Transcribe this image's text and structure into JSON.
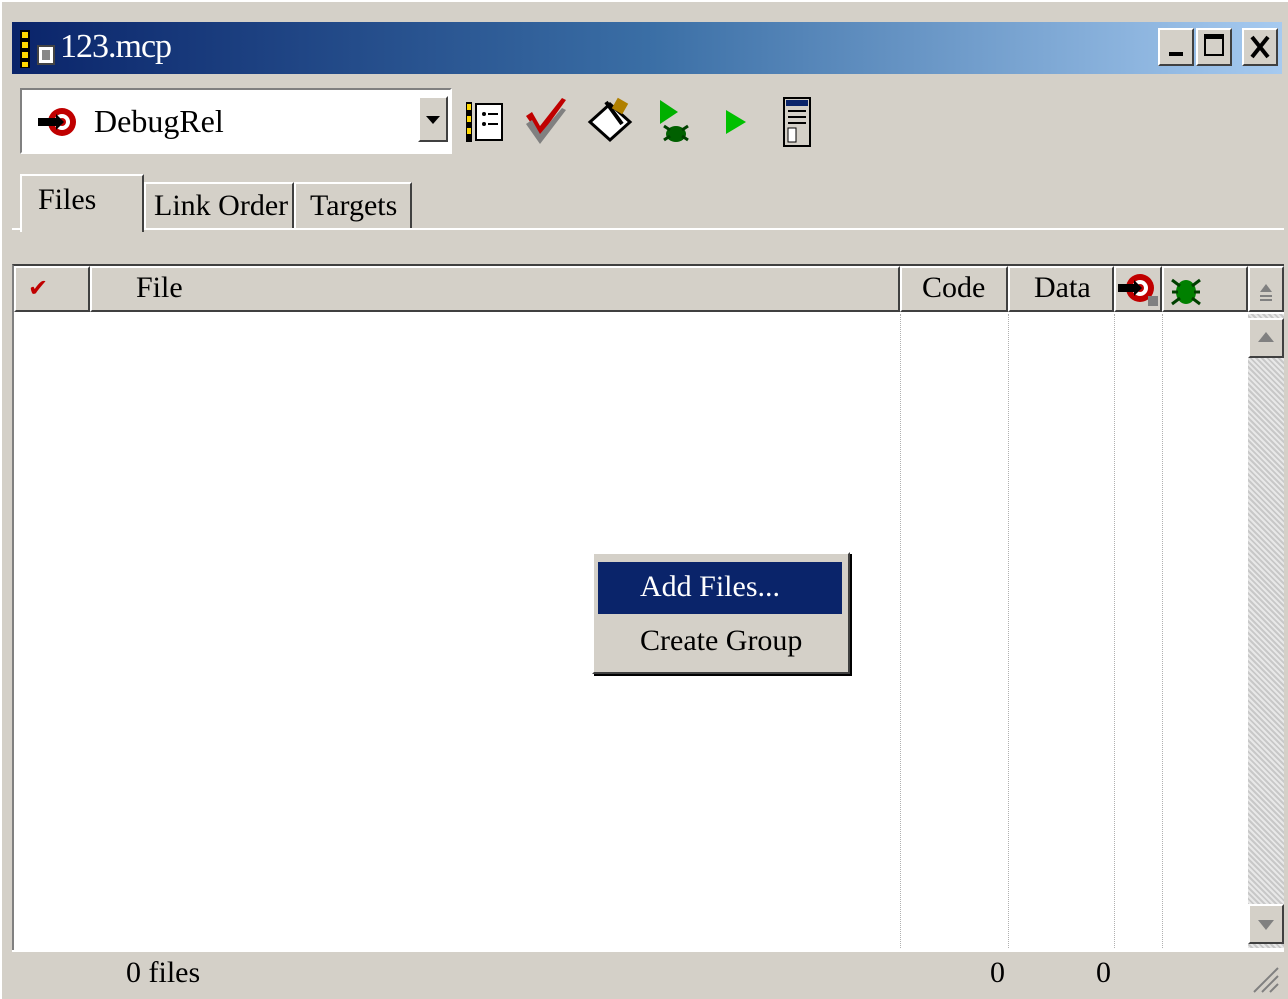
{
  "window": {
    "title": "123.mcp",
    "min_glyph": "_",
    "max_glyph": "□",
    "close_glyph": "×"
  },
  "toolbar": {
    "target_selected": "DebugRel",
    "icons": [
      "target-settings-icon",
      "check-syntax-icon",
      "compile-icon",
      "debug-icon",
      "run-icon",
      "project-inspector-icon"
    ]
  },
  "tabs": [
    {
      "label": "Files",
      "selected": true
    },
    {
      "label": "Link Order",
      "selected": false
    },
    {
      "label": "Targets",
      "selected": false
    }
  ],
  "columns": {
    "check": "✔",
    "file": "File",
    "code": "Code",
    "data": "Data",
    "target_icon": "target-icon",
    "debug_icon": "bug-icon"
  },
  "status": {
    "file_count": "0 files",
    "code_total": "0",
    "data_total": "0"
  },
  "context_menu": {
    "items": [
      {
        "label": "Add Files...",
        "highlighted": true
      },
      {
        "label": "Create Group",
        "highlighted": false
      }
    ]
  },
  "colors": {
    "title_start": "#0a246a",
    "title_end": "#a6caf0",
    "face": "#d4d0c8",
    "highlight": "#0a246a"
  }
}
